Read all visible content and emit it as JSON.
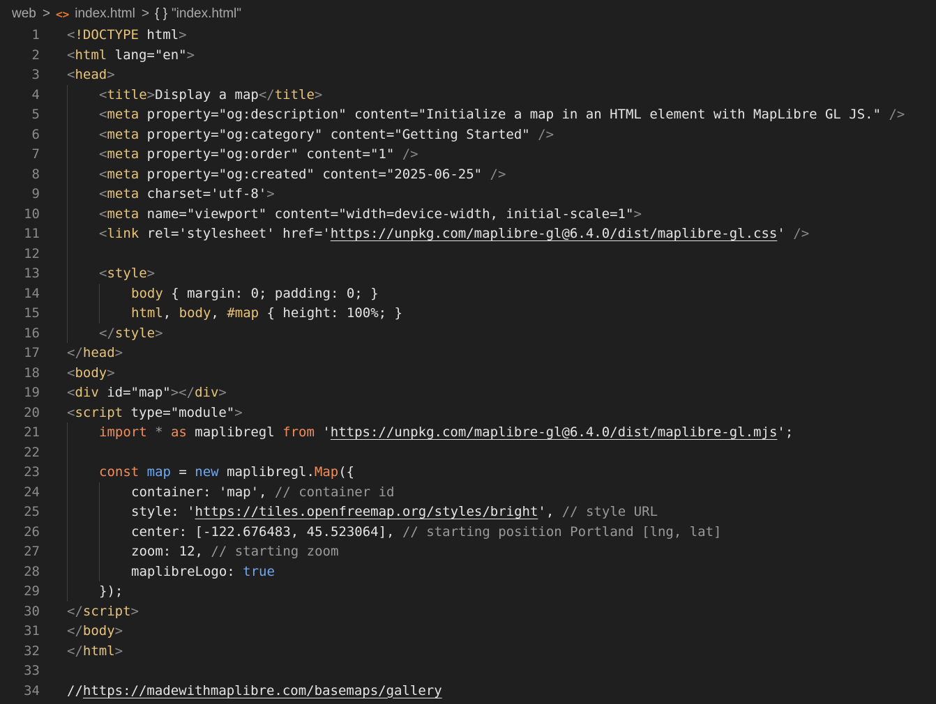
{
  "breadcrumb": {
    "folder": "web",
    "file": "index.html",
    "symbol": "\"index.html\"",
    "file_icon": "html-file-icon",
    "symbol_icon": "braces-icon"
  },
  "colors": {
    "background": "#1f1f1f",
    "line_number": "#8b8b8b",
    "tag_name": "#e8c47a",
    "keyword": "#f48c5c",
    "bracket": "#8a8a8a"
  },
  "lines": [
    {
      "n": "1",
      "indent": 0,
      "tokens": [
        [
          "br",
          "<"
        ],
        [
          "tag",
          "!DOCTYPE"
        ],
        [
          "txt",
          " html"
        ],
        [
          "br",
          ">"
        ]
      ]
    },
    {
      "n": "2",
      "indent": 0,
      "tokens": [
        [
          "br",
          "<"
        ],
        [
          "tag",
          "html"
        ],
        [
          "txt",
          " lang=\"en\""
        ],
        [
          "br",
          ">"
        ]
      ]
    },
    {
      "n": "3",
      "indent": 0,
      "tokens": [
        [
          "br",
          "<"
        ],
        [
          "tag",
          "head"
        ],
        [
          "br",
          ">"
        ]
      ]
    },
    {
      "n": "4",
      "indent": 1,
      "tokens": [
        [
          "br",
          "<"
        ],
        [
          "tag",
          "title"
        ],
        [
          "br",
          ">"
        ],
        [
          "txt",
          "Display a map"
        ],
        [
          "br",
          "</"
        ],
        [
          "tag",
          "title"
        ],
        [
          "br",
          ">"
        ]
      ]
    },
    {
      "n": "5",
      "indent": 1,
      "tokens": [
        [
          "br",
          "<"
        ],
        [
          "tag",
          "meta"
        ],
        [
          "txt",
          " property=\"og:description\" content=\"Initialize a map in an HTML element with MapLibre GL JS.\" "
        ],
        [
          "br",
          "/>"
        ]
      ]
    },
    {
      "n": "6",
      "indent": 1,
      "tokens": [
        [
          "br",
          "<"
        ],
        [
          "tag",
          "meta"
        ],
        [
          "txt",
          " property=\"og:category\" content=\"Getting Started\" "
        ],
        [
          "br",
          "/>"
        ]
      ]
    },
    {
      "n": "7",
      "indent": 1,
      "tokens": [
        [
          "br",
          "<"
        ],
        [
          "tag",
          "meta"
        ],
        [
          "txt",
          " property=\"og:order\" content=\"1\" "
        ],
        [
          "br",
          "/>"
        ]
      ]
    },
    {
      "n": "8",
      "indent": 1,
      "tokens": [
        [
          "br",
          "<"
        ],
        [
          "tag",
          "meta"
        ],
        [
          "txt",
          " property=\"og:created\" content=\"2025-06-25\" "
        ],
        [
          "br",
          "/>"
        ]
      ]
    },
    {
      "n": "9",
      "indent": 1,
      "tokens": [
        [
          "br",
          "<"
        ],
        [
          "tag",
          "meta"
        ],
        [
          "txt",
          " charset='utf-8'"
        ],
        [
          "br",
          ">"
        ]
      ]
    },
    {
      "n": "10",
      "indent": 1,
      "tokens": [
        [
          "br",
          "<"
        ],
        [
          "tag",
          "meta"
        ],
        [
          "txt",
          " name=\"viewport\" content=\"width=device-width, initial-scale=1\""
        ],
        [
          "br",
          ">"
        ]
      ]
    },
    {
      "n": "11",
      "indent": 1,
      "tokens": [
        [
          "br",
          "<"
        ],
        [
          "tag",
          "link"
        ],
        [
          "txt",
          " rel='stylesheet' href='"
        ],
        [
          "url",
          "https://unpkg.com/maplibre-gl@6.4.0/dist/maplibre-gl.css"
        ],
        [
          "txt",
          "' "
        ],
        [
          "br",
          "/>"
        ]
      ]
    },
    {
      "n": "12",
      "indent": 1,
      "tokens": []
    },
    {
      "n": "13",
      "indent": 1,
      "tokens": [
        [
          "br",
          "<"
        ],
        [
          "tag",
          "style"
        ],
        [
          "br",
          ">"
        ]
      ]
    },
    {
      "n": "14",
      "indent": 2,
      "tokens": [
        [
          "sel",
          "body"
        ],
        [
          "txt",
          " { margin: 0; padding: 0; }"
        ]
      ]
    },
    {
      "n": "15",
      "indent": 2,
      "tokens": [
        [
          "sel",
          "html"
        ],
        [
          "txt",
          ", "
        ],
        [
          "sel",
          "body"
        ],
        [
          "txt",
          ", "
        ],
        [
          "sel",
          "#map"
        ],
        [
          "txt",
          " { height: 100%; }"
        ]
      ]
    },
    {
      "n": "16",
      "indent": 1,
      "tokens": [
        [
          "br",
          "</"
        ],
        [
          "tag",
          "style"
        ],
        [
          "br",
          ">"
        ]
      ]
    },
    {
      "n": "17",
      "indent": 0,
      "tokens": [
        [
          "br",
          "</"
        ],
        [
          "tag",
          "head"
        ],
        [
          "br",
          ">"
        ]
      ]
    },
    {
      "n": "18",
      "indent": 0,
      "tokens": [
        [
          "br",
          "<"
        ],
        [
          "tag",
          "body"
        ],
        [
          "br",
          ">"
        ]
      ]
    },
    {
      "n": "19",
      "indent": 0,
      "tokens": [
        [
          "br",
          "<"
        ],
        [
          "tag",
          "div"
        ],
        [
          "txt",
          " id=\"map\""
        ],
        [
          "br",
          "></"
        ],
        [
          "tag",
          "div"
        ],
        [
          "br",
          ">"
        ]
      ]
    },
    {
      "n": "20",
      "indent": 0,
      "tokens": [
        [
          "br",
          "<"
        ],
        [
          "tag",
          "script"
        ],
        [
          "txt",
          " type=\"module\""
        ],
        [
          "br",
          ">"
        ]
      ]
    },
    {
      "n": "21",
      "indent": 1,
      "tokens": [
        [
          "kw",
          "import"
        ],
        [
          "cmt",
          " * "
        ],
        [
          "kw",
          "as"
        ],
        [
          "txt",
          " maplibregl "
        ],
        [
          "kw",
          "from"
        ],
        [
          "txt",
          " '"
        ],
        [
          "url",
          "https://unpkg.com/maplibre-gl@6.4.0/dist/maplibre-gl.mjs"
        ],
        [
          "txt",
          "';"
        ]
      ]
    },
    {
      "n": "22",
      "indent": 1,
      "tokens": []
    },
    {
      "n": "23",
      "indent": 1,
      "tokens": [
        [
          "kw",
          "const"
        ],
        [
          "key",
          " map"
        ],
        [
          "txt",
          " = "
        ],
        [
          "key",
          "new"
        ],
        [
          "txt",
          " maplibregl."
        ],
        [
          "kw",
          "Map"
        ],
        [
          "txt",
          "({"
        ]
      ]
    },
    {
      "n": "24",
      "indent": 2,
      "tokens": [
        [
          "txt",
          "container: 'map', "
        ],
        [
          "cmt",
          "// container id"
        ]
      ]
    },
    {
      "n": "25",
      "indent": 2,
      "tokens": [
        [
          "txt",
          "style: '"
        ],
        [
          "url",
          "https://tiles.openfreemap.org/styles/bright"
        ],
        [
          "txt",
          "', "
        ],
        [
          "cmt",
          "// style URL"
        ]
      ]
    },
    {
      "n": "26",
      "indent": 2,
      "tokens": [
        [
          "txt",
          "center: [-122.676483, 45.523064], "
        ],
        [
          "cmt",
          "// starting position Portland [lng, lat]"
        ]
      ]
    },
    {
      "n": "27",
      "indent": 2,
      "tokens": [
        [
          "txt",
          "zoom: 12, "
        ],
        [
          "cmt",
          "// starting zoom"
        ]
      ]
    },
    {
      "n": "28",
      "indent": 2,
      "tokens": [
        [
          "txt",
          "maplibreLogo: "
        ],
        [
          "key",
          "true"
        ]
      ]
    },
    {
      "n": "29",
      "indent": 1,
      "tokens": [
        [
          "txt",
          "});"
        ]
      ]
    },
    {
      "n": "30",
      "indent": 0,
      "tokens": [
        [
          "br",
          "</"
        ],
        [
          "tag",
          "script"
        ],
        [
          "br",
          ">"
        ]
      ]
    },
    {
      "n": "31",
      "indent": 0,
      "tokens": [
        [
          "br",
          "</"
        ],
        [
          "tag",
          "body"
        ],
        [
          "br",
          ">"
        ]
      ]
    },
    {
      "n": "32",
      "indent": 0,
      "tokens": [
        [
          "br",
          "</"
        ],
        [
          "tag",
          "html"
        ],
        [
          "br",
          ">"
        ]
      ]
    },
    {
      "n": "33",
      "indent": 0,
      "tokens": []
    },
    {
      "n": "34",
      "indent": 0,
      "tokens": [
        [
          "txt",
          "//"
        ],
        [
          "url",
          "https://madewithmaplibre.com/basemaps/gallery"
        ]
      ]
    }
  ]
}
